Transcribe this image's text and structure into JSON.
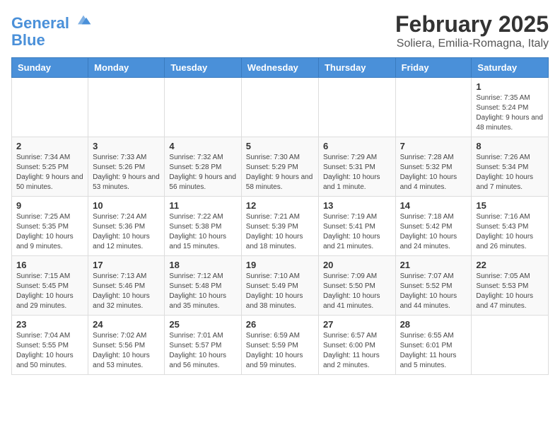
{
  "logo": {
    "line1": "General",
    "line2": "Blue"
  },
  "header": {
    "month": "February 2025",
    "location": "Soliera, Emilia-Romagna, Italy"
  },
  "weekdays": [
    "Sunday",
    "Monday",
    "Tuesday",
    "Wednesday",
    "Thursday",
    "Friday",
    "Saturday"
  ],
  "weeks": [
    [
      {
        "day": "",
        "info": ""
      },
      {
        "day": "",
        "info": ""
      },
      {
        "day": "",
        "info": ""
      },
      {
        "day": "",
        "info": ""
      },
      {
        "day": "",
        "info": ""
      },
      {
        "day": "",
        "info": ""
      },
      {
        "day": "1",
        "info": "Sunrise: 7:35 AM\nSunset: 5:24 PM\nDaylight: 9 hours and 48 minutes."
      }
    ],
    [
      {
        "day": "2",
        "info": "Sunrise: 7:34 AM\nSunset: 5:25 PM\nDaylight: 9 hours and 50 minutes."
      },
      {
        "day": "3",
        "info": "Sunrise: 7:33 AM\nSunset: 5:26 PM\nDaylight: 9 hours and 53 minutes."
      },
      {
        "day": "4",
        "info": "Sunrise: 7:32 AM\nSunset: 5:28 PM\nDaylight: 9 hours and 56 minutes."
      },
      {
        "day": "5",
        "info": "Sunrise: 7:30 AM\nSunset: 5:29 PM\nDaylight: 9 hours and 58 minutes."
      },
      {
        "day": "6",
        "info": "Sunrise: 7:29 AM\nSunset: 5:31 PM\nDaylight: 10 hours and 1 minute."
      },
      {
        "day": "7",
        "info": "Sunrise: 7:28 AM\nSunset: 5:32 PM\nDaylight: 10 hours and 4 minutes."
      },
      {
        "day": "8",
        "info": "Sunrise: 7:26 AM\nSunset: 5:34 PM\nDaylight: 10 hours and 7 minutes."
      }
    ],
    [
      {
        "day": "9",
        "info": "Sunrise: 7:25 AM\nSunset: 5:35 PM\nDaylight: 10 hours and 9 minutes."
      },
      {
        "day": "10",
        "info": "Sunrise: 7:24 AM\nSunset: 5:36 PM\nDaylight: 10 hours and 12 minutes."
      },
      {
        "day": "11",
        "info": "Sunrise: 7:22 AM\nSunset: 5:38 PM\nDaylight: 10 hours and 15 minutes."
      },
      {
        "day": "12",
        "info": "Sunrise: 7:21 AM\nSunset: 5:39 PM\nDaylight: 10 hours and 18 minutes."
      },
      {
        "day": "13",
        "info": "Sunrise: 7:19 AM\nSunset: 5:41 PM\nDaylight: 10 hours and 21 minutes."
      },
      {
        "day": "14",
        "info": "Sunrise: 7:18 AM\nSunset: 5:42 PM\nDaylight: 10 hours and 24 minutes."
      },
      {
        "day": "15",
        "info": "Sunrise: 7:16 AM\nSunset: 5:43 PM\nDaylight: 10 hours and 26 minutes."
      }
    ],
    [
      {
        "day": "16",
        "info": "Sunrise: 7:15 AM\nSunset: 5:45 PM\nDaylight: 10 hours and 29 minutes."
      },
      {
        "day": "17",
        "info": "Sunrise: 7:13 AM\nSunset: 5:46 PM\nDaylight: 10 hours and 32 minutes."
      },
      {
        "day": "18",
        "info": "Sunrise: 7:12 AM\nSunset: 5:48 PM\nDaylight: 10 hours and 35 minutes."
      },
      {
        "day": "19",
        "info": "Sunrise: 7:10 AM\nSunset: 5:49 PM\nDaylight: 10 hours and 38 minutes."
      },
      {
        "day": "20",
        "info": "Sunrise: 7:09 AM\nSunset: 5:50 PM\nDaylight: 10 hours and 41 minutes."
      },
      {
        "day": "21",
        "info": "Sunrise: 7:07 AM\nSunset: 5:52 PM\nDaylight: 10 hours and 44 minutes."
      },
      {
        "day": "22",
        "info": "Sunrise: 7:05 AM\nSunset: 5:53 PM\nDaylight: 10 hours and 47 minutes."
      }
    ],
    [
      {
        "day": "23",
        "info": "Sunrise: 7:04 AM\nSunset: 5:55 PM\nDaylight: 10 hours and 50 minutes."
      },
      {
        "day": "24",
        "info": "Sunrise: 7:02 AM\nSunset: 5:56 PM\nDaylight: 10 hours and 53 minutes."
      },
      {
        "day": "25",
        "info": "Sunrise: 7:01 AM\nSunset: 5:57 PM\nDaylight: 10 hours and 56 minutes."
      },
      {
        "day": "26",
        "info": "Sunrise: 6:59 AM\nSunset: 5:59 PM\nDaylight: 10 hours and 59 minutes."
      },
      {
        "day": "27",
        "info": "Sunrise: 6:57 AM\nSunset: 6:00 PM\nDaylight: 11 hours and 2 minutes."
      },
      {
        "day": "28",
        "info": "Sunrise: 6:55 AM\nSunset: 6:01 PM\nDaylight: 11 hours and 5 minutes."
      },
      {
        "day": "",
        "info": ""
      }
    ]
  ]
}
